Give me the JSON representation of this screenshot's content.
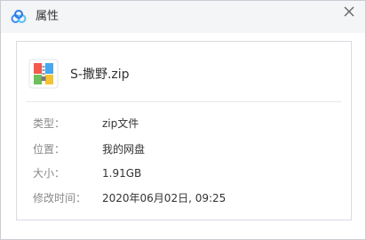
{
  "window": {
    "title": "属性",
    "app_icon": "cloud-icon",
    "close_icon": "close-icon"
  },
  "file": {
    "icon": "zip-archive-icon",
    "name": "S-撒野.zip"
  },
  "properties": [
    {
      "label": "类型：",
      "value": "zip文件"
    },
    {
      "label": "位置：",
      "value": "我的网盘"
    },
    {
      "label": "大小：",
      "value": "1.91GB"
    },
    {
      "label": "修改时间：",
      "value": "2020年06月02日, 09:25"
    }
  ],
  "colors": {
    "titlebar_bg": "#f4f5f7",
    "border": "#c9ccd2",
    "label_text": "#888888",
    "value_text": "#333333",
    "brand_blue": "#3b8cf5"
  }
}
